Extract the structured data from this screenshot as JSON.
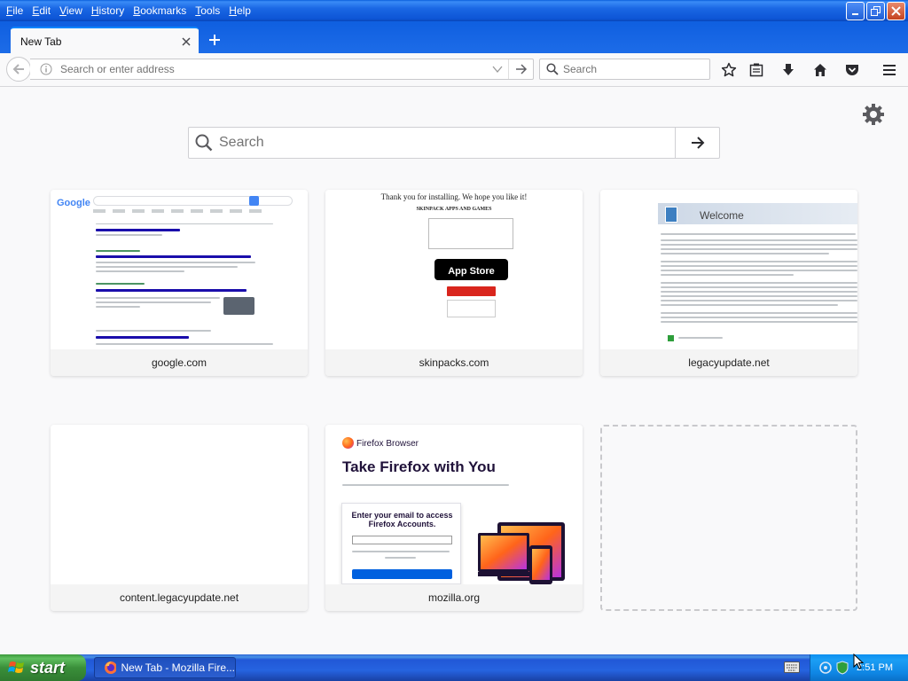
{
  "menubar": {
    "items": [
      "File",
      "Edit",
      "View",
      "History",
      "Bookmarks",
      "Tools",
      "Help"
    ]
  },
  "tabs": [
    {
      "title": "New Tab",
      "active": true
    }
  ],
  "navbar": {
    "url_placeholder": "Search or enter address",
    "search_placeholder": "Search"
  },
  "newtab": {
    "search_placeholder": "Search",
    "tiles": [
      {
        "label": "google.com"
      },
      {
        "label": "skinpacks.com"
      },
      {
        "label": "legacyupdate.net"
      },
      {
        "label": "content.legacyupdate.net"
      },
      {
        "label": "mozilla.org"
      }
    ]
  },
  "thumbs": {
    "skinpacks": {
      "thanks": "Thank you for installing. We hope you like it!",
      "heading": "SKINPACK APPS AND GAMES",
      "store": "App Store"
    },
    "legacy": {
      "welcome": "Welcome"
    },
    "mozilla": {
      "brand": "Firefox Browser",
      "title": "Take Firefox with You",
      "form_title": "Enter your email to access Firefox Accounts."
    }
  },
  "taskbar": {
    "start_label": "start",
    "task_label": "New Tab - Mozilla Fire...",
    "clock": "2:51 PM"
  },
  "colors": {
    "accent": "#0a84ff",
    "xp_blue": "#245edb",
    "start_green": "#3a8f3a"
  }
}
